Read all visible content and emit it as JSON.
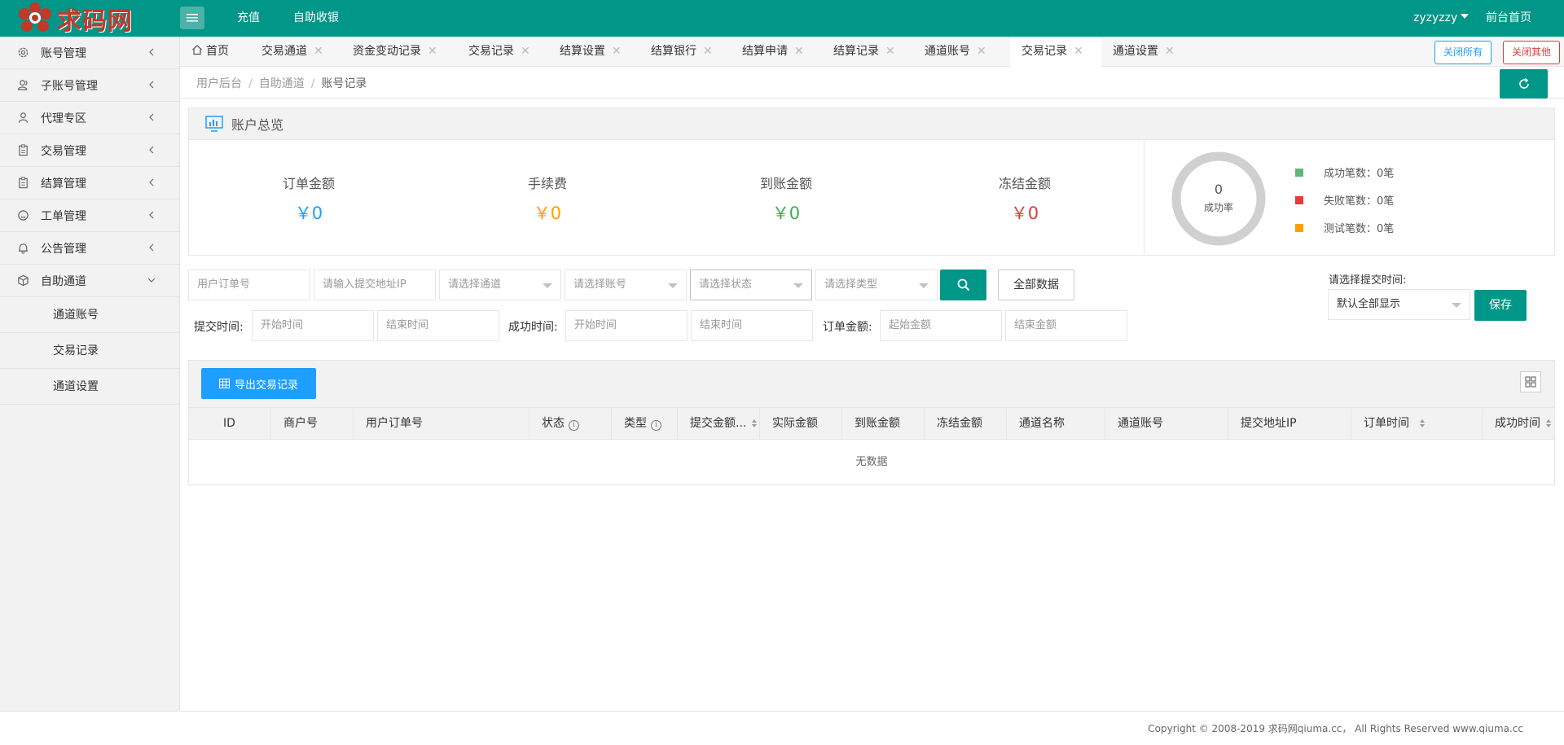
{
  "header": {
    "logo_text": "求码网",
    "nav": [
      "充值",
      "自助收银"
    ],
    "user": "zyzyzzy",
    "home_link": "前台首页"
  },
  "sidebar": {
    "items": [
      {
        "label": "账号管理",
        "icon": "gear-icon"
      },
      {
        "label": "子账号管理",
        "icon": "users-icon"
      },
      {
        "label": "代理专区",
        "icon": "user-icon"
      },
      {
        "label": "交易管理",
        "icon": "clipboard-icon"
      },
      {
        "label": "结算管理",
        "icon": "clipboard-icon"
      },
      {
        "label": "工单管理",
        "icon": "smile-icon"
      },
      {
        "label": "公告管理",
        "icon": "bell-icon"
      },
      {
        "label": "自助通道",
        "icon": "cube-icon"
      }
    ],
    "sub_items": [
      "通道账号",
      "交易记录",
      "通道设置"
    ]
  },
  "tabs": {
    "items": [
      "首页",
      "交易通道",
      "资金变动记录",
      "交易记录",
      "结算设置",
      "结算银行",
      "结算申请",
      "结算记录",
      "通道账号",
      "交易记录",
      "通道设置"
    ],
    "active_index": 9,
    "close_all": "关闭所有",
    "close_others": "关闭其他"
  },
  "breadcrumb": [
    "用户后台",
    "自助通道",
    "账号记录"
  ],
  "overview": {
    "title": "账户总览",
    "stats": [
      {
        "label": "订单金额",
        "value": "￥0",
        "color": "#1e9fff"
      },
      {
        "label": "手续费",
        "value": "￥0",
        "color": "#ffa000"
      },
      {
        "label": "到账金额",
        "value": "￥0",
        "color": "#3db04d"
      },
      {
        "label": "冻结金额",
        "value": "￥0",
        "color": "#e23b3b"
      }
    ],
    "donut_value": "0",
    "donut_label": "成功率",
    "legend": [
      {
        "label": "成功笔数：0笔",
        "color": "#5fb878"
      },
      {
        "label": "失败笔数：0笔",
        "color": "#e23b3b"
      },
      {
        "label": "测试笔数：0笔",
        "color": "#ffa000"
      }
    ]
  },
  "filters": {
    "order_no": "用户订单号",
    "ip": "请输入提交地址IP",
    "channel": "请选择通道",
    "account": "请选择账号",
    "status": "请选择状态",
    "type": "请选择类型",
    "all_data": "全部数据",
    "submit_time_label": "提交时间:",
    "success_time_label": "成功时间:",
    "amount_label": "订单金额:",
    "start_time": "开始时间",
    "end_time": "结束时间",
    "start_amount": "起始金额",
    "end_amount": "结束金额",
    "time_select_label": "请选择提交时间:",
    "time_select_value": "默认全部显示",
    "save": "保存"
  },
  "table": {
    "export": "导出交易记录",
    "columns": [
      "ID",
      "商户号",
      "用户订单号",
      "状态",
      "类型",
      "提交金额...",
      "实际金额",
      "到账金额",
      "冻结金额",
      "通道名称",
      "通道账号",
      "提交地址IP",
      "订单时间",
      "成功时间"
    ],
    "empty": "无数据"
  },
  "footer": "Copyright © 2008-2019 求码网qiuma.cc， All Rights Reserved www.qiuma.cc"
}
